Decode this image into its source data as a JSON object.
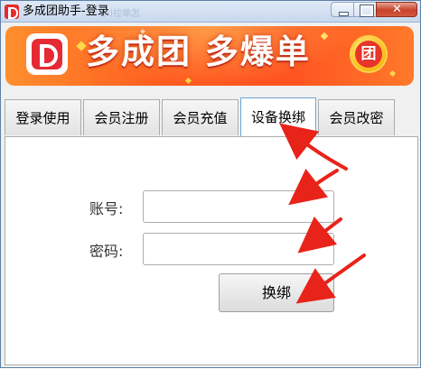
{
  "window": {
    "title": "多成团助手-登录",
    "background_title": "川拉单怎",
    "icon": "app-logo-icon"
  },
  "banner": {
    "slogan": "多成团 多爆单",
    "coin_text": "团",
    "logo_icon": "duo-logo-icon",
    "colors": {
      "start": "#ff8f2e",
      "mid": "#ff5320",
      "text": "#ffffff"
    }
  },
  "tabs": [
    {
      "label": "登录使用",
      "active": false
    },
    {
      "label": "会员注册",
      "active": false
    },
    {
      "label": "会员充值",
      "active": false
    },
    {
      "label": "设备换绑",
      "active": true
    },
    {
      "label": "会员改密",
      "active": false
    }
  ],
  "form": {
    "account": {
      "label": "账号:",
      "value": "",
      "placeholder": ""
    },
    "password": {
      "label": "密码:",
      "value": "",
      "placeholder": ""
    },
    "submit_label": "换绑"
  },
  "annotations": {
    "arrow_color": "#e8231a",
    "count": 4
  }
}
